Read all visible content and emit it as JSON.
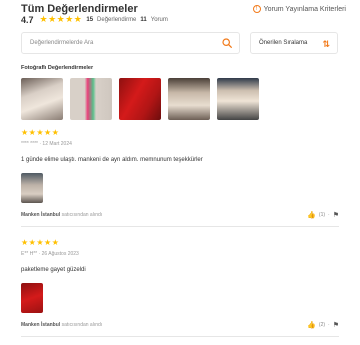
{
  "header": {
    "title": "Tüm Değerlendirmeler",
    "criteria_link": "Yorum Yayınlama Kriterleri"
  },
  "summary": {
    "rating": "4.7",
    "review_count": "15",
    "review_label": "Değerlendirme",
    "comment_count": "11",
    "comment_label": "Yorum"
  },
  "search": {
    "placeholder": "Değerlendirmelerde Ara"
  },
  "sort": {
    "label": "Önerilen Sıralama"
  },
  "photos": {
    "label": "Fotoğraflı Değerlendirmeler",
    "count": 5
  },
  "reviews": [
    {
      "stars": "★★★★★",
      "author": "**** ****",
      "date": "12 Mart 2024",
      "text": "1 günde elime ulaştı. mankeni de ayn aldım. memnunum teşekkürler",
      "seller": "Manken İstanbul",
      "seller_suffix": "satıcısından alındı",
      "likes": "(1)"
    },
    {
      "stars": "★★★★★",
      "author": "E** H**",
      "date": "26 Ağustos 2023",
      "text": "paketleme gayet güzeldi",
      "seller": "Manken İstanbul",
      "seller_suffix": "satıcısından alındı",
      "likes": "(2)"
    }
  ],
  "colors": {
    "accent": "#f27a1a",
    "star": "#ffc000"
  }
}
